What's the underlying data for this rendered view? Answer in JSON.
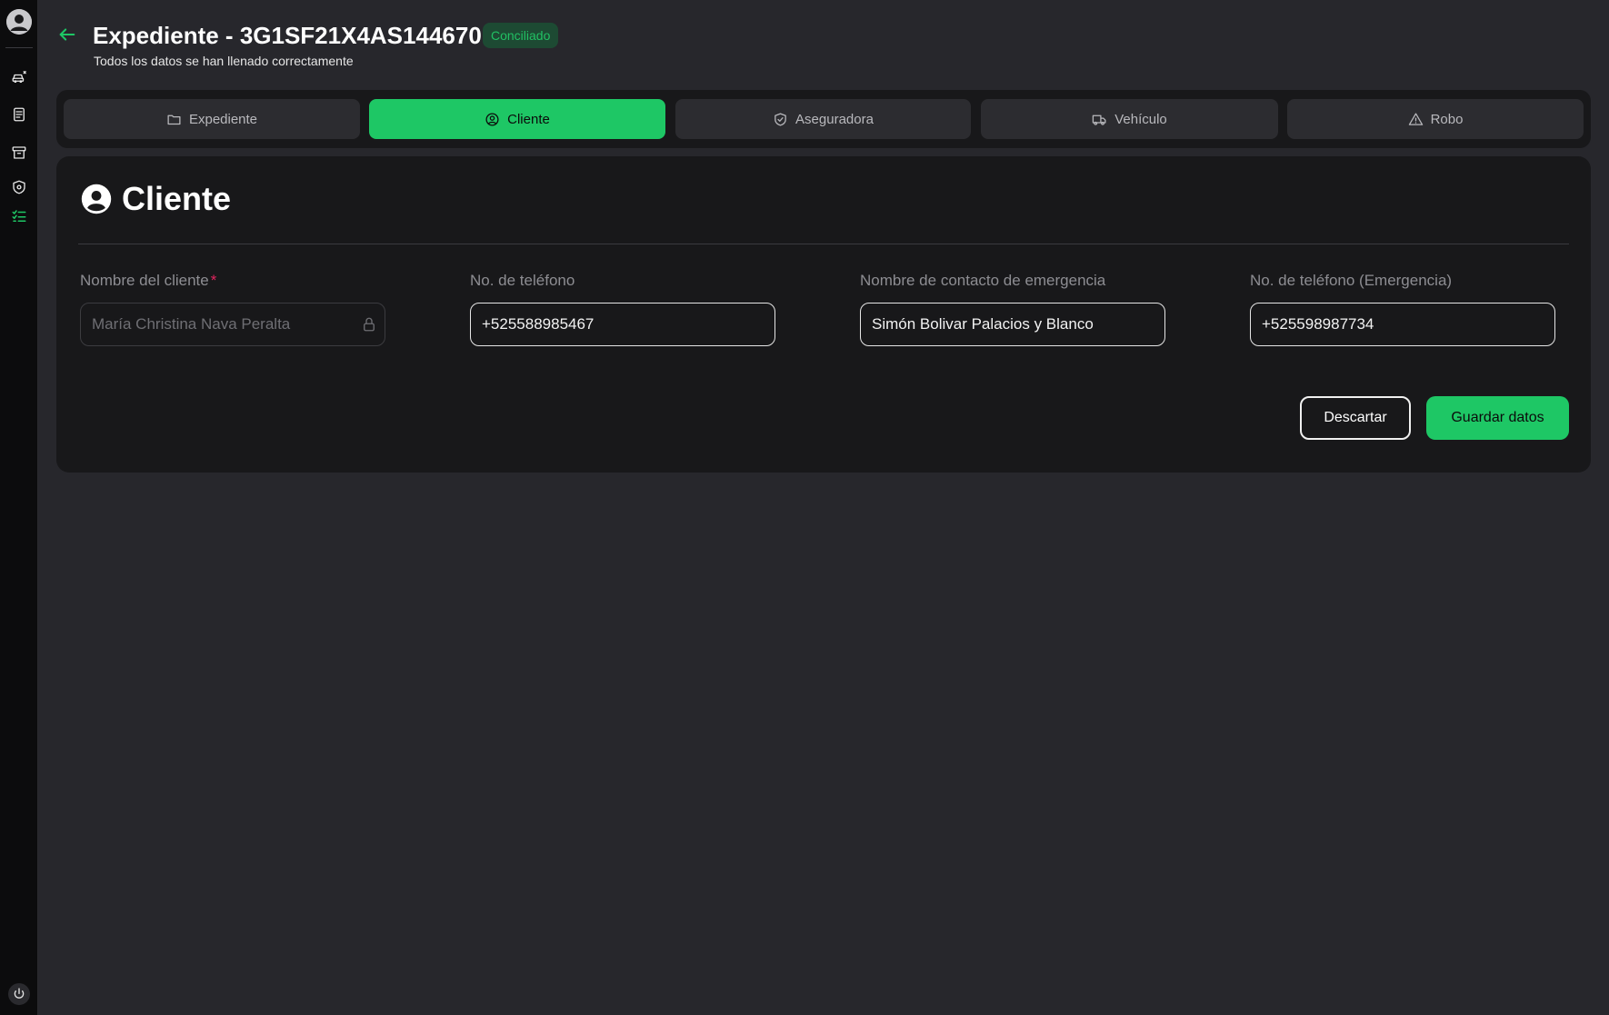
{
  "header": {
    "title": "Expediente - 3G1SF21X4AS144670",
    "status": "Conciliado",
    "subtitle": "Todos los datos se han llenado correctamente"
  },
  "sidebar": {
    "items": [
      {
        "icon": "user-avatar-icon"
      },
      {
        "icon": "car-icon"
      },
      {
        "icon": "document-icon"
      },
      {
        "icon": "archive-icon"
      },
      {
        "icon": "shield-icon"
      },
      {
        "icon": "checklist-icon",
        "active": true
      },
      {
        "icon": "power-icon"
      }
    ]
  },
  "tabs": [
    {
      "label": "Expediente",
      "icon": "folder-icon"
    },
    {
      "label": "Cliente",
      "icon": "user-circle-icon",
      "active": true
    },
    {
      "label": "Aseguradora",
      "icon": "shield-check-icon"
    },
    {
      "label": "Vehículo",
      "icon": "truck-icon"
    },
    {
      "label": "Robo",
      "icon": "warning-icon"
    }
  ],
  "card": {
    "title": "Cliente",
    "fields": [
      {
        "label": "Nombre del cliente",
        "required": true,
        "value": "María Christina Nava Peralta",
        "disabled": true
      },
      {
        "label": "No. de teléfono",
        "value": "+525588985467"
      },
      {
        "label": "Nombre de contacto de emergencia",
        "value": "Simón Bolivar Palacios y Blanco"
      },
      {
        "label": "No. de teléfono (Emergencia)",
        "value": "+525598987734"
      }
    ],
    "buttons": {
      "discard": "Descartar",
      "save": "Guardar datos"
    }
  },
  "colors": {
    "accent": "#1ec765",
    "background": "#27272c",
    "card": "#18181a",
    "required": "#e0245e"
  }
}
